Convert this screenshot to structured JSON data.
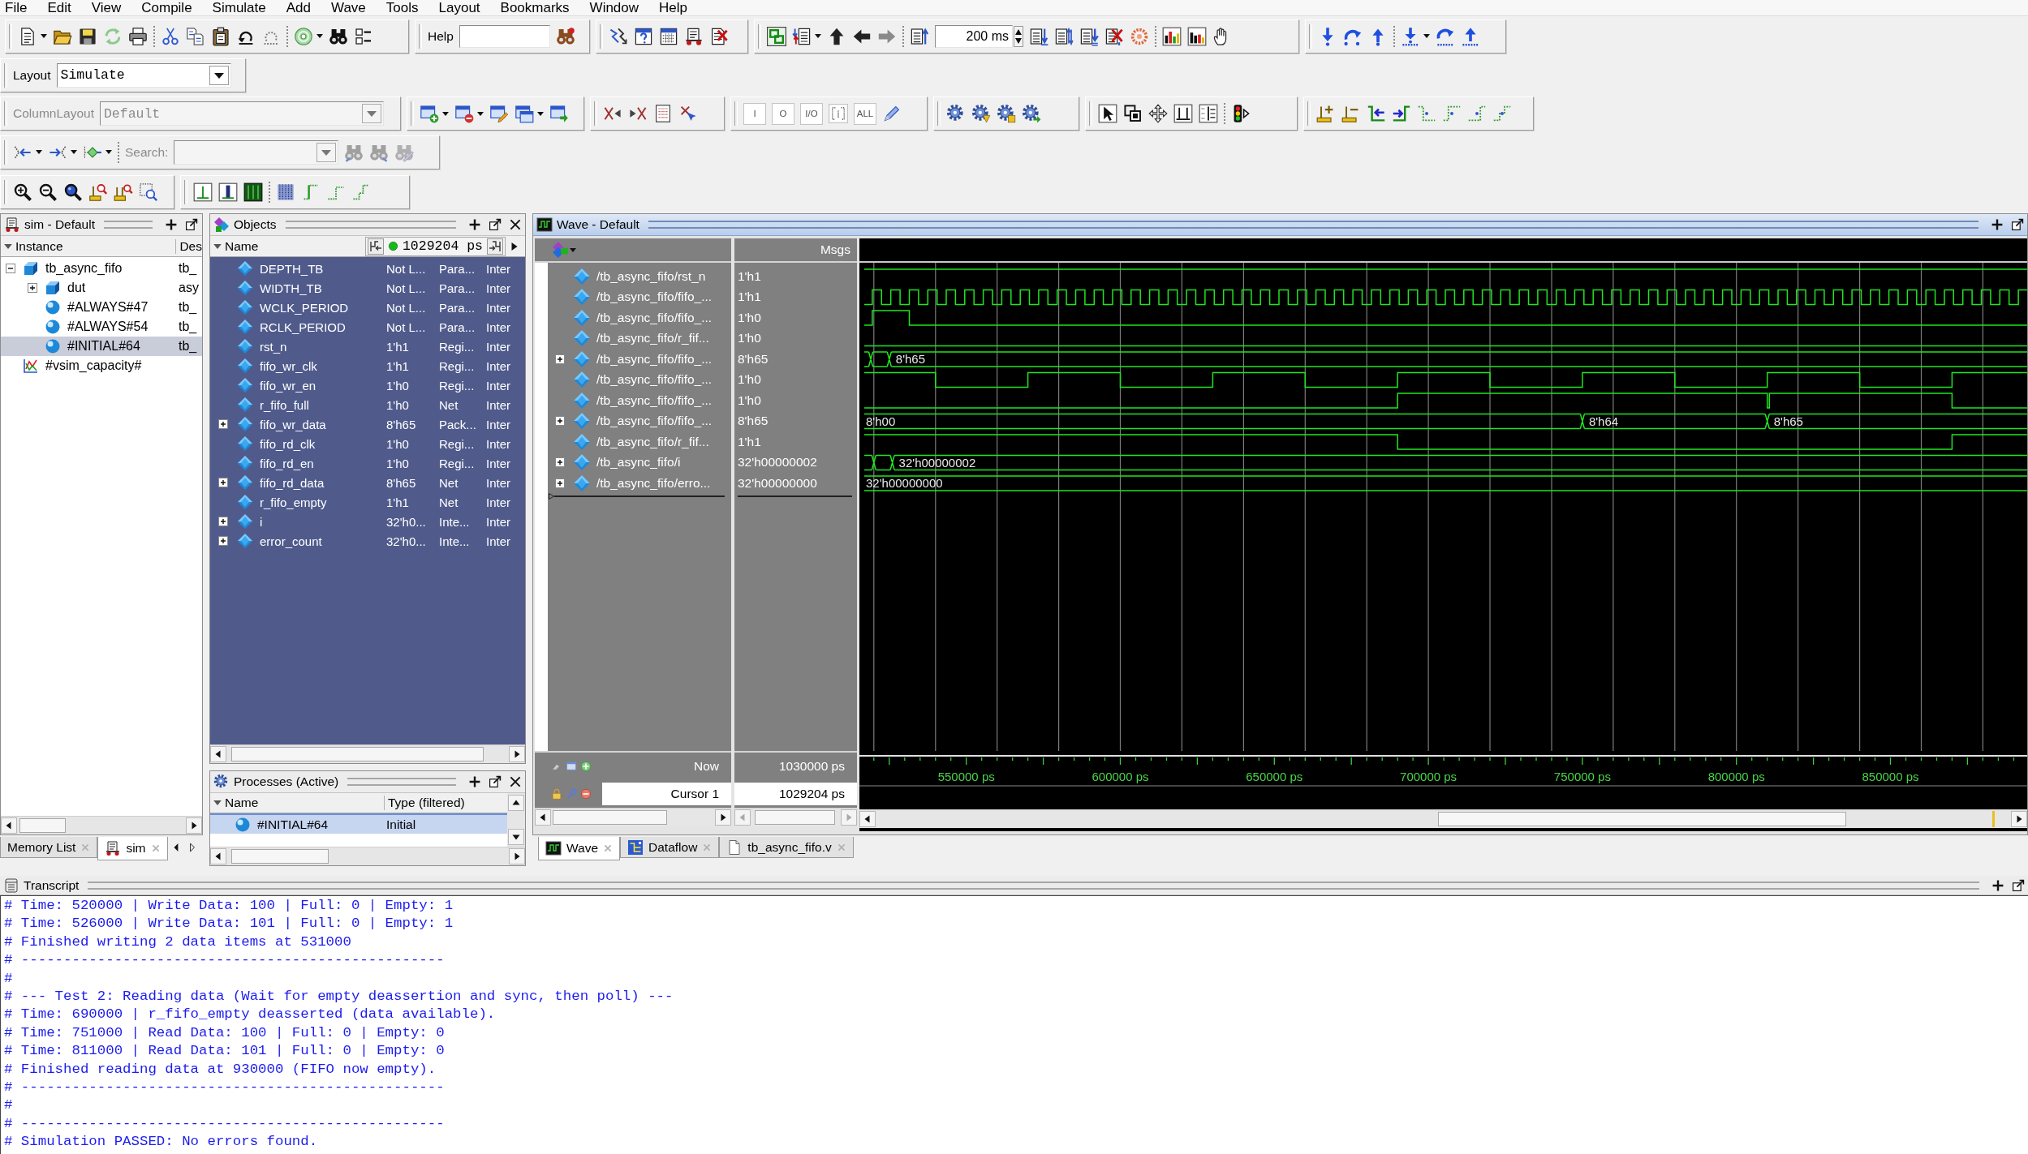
{
  "menu_bar": [
    "File",
    "Edit",
    "View",
    "Compile",
    "Simulate",
    "Add",
    "Wave",
    "Tools",
    "Layout",
    "Bookmarks",
    "Window",
    "Help"
  ],
  "toolbar": {
    "help_label": "Help",
    "run_length": "200 ms",
    "layout": {
      "label": "Layout",
      "value": "Simulate"
    },
    "column_layout": {
      "label": "ColumnLayout",
      "value": "Default",
      "disabled": true
    },
    "object_filters": [
      "I",
      "O",
      "I/O",
      "ALL"
    ],
    "search": {
      "label": "Search:",
      "disabled": true
    }
  },
  "sim_panel": {
    "title": "sim - Default",
    "columns": [
      "Instance",
      "Des"
    ],
    "tree": [
      {
        "name": "tb_async_fifo",
        "design": "tb_",
        "kind": "module",
        "expanded": true,
        "selected": false,
        "children": [
          {
            "name": "dut",
            "design": "asy",
            "kind": "module",
            "expanded": false,
            "selected": false
          },
          {
            "name": "#ALWAYS#47",
            "design": "tb_",
            "kind": "process",
            "selected": false
          },
          {
            "name": "#ALWAYS#54",
            "design": "tb_",
            "kind": "process",
            "selected": false
          },
          {
            "name": "#INITIAL#64",
            "design": "tb_",
            "kind": "process",
            "selected": true
          }
        ]
      },
      {
        "name": "#vsim_capacity#",
        "kind": "capacity",
        "selected": false
      }
    ],
    "tabs": [
      {
        "label": "Memory List",
        "kind": "memory",
        "selected": false
      },
      {
        "label": "sim",
        "kind": "sim",
        "selected": true
      }
    ]
  },
  "objects_panel": {
    "title": "Objects",
    "column": "Name",
    "time": "1029204 ps",
    "rows": [
      {
        "name": "DEPTH_TB",
        "value": "Not L...",
        "column_3": "Para...",
        "column_4": "Inter"
      },
      {
        "name": "WIDTH_TB",
        "value": "Not L...",
        "column_3": "Para...",
        "column_4": "Inter"
      },
      {
        "name": "WCLK_PERIOD",
        "value": "Not L...",
        "column_3": "Para...",
        "column_4": "Inter"
      },
      {
        "name": "RCLK_PERIOD",
        "value": "Not L...",
        "column_3": "Para...",
        "column_4": "Inter"
      },
      {
        "name": "rst_n",
        "value": "1'h1",
        "column_3": "Regi...",
        "column_4": "Inter"
      },
      {
        "name": "fifo_wr_clk",
        "value": "1'h1",
        "column_3": "Regi...",
        "column_4": "Inter"
      },
      {
        "name": "fifo_wr_en",
        "value": "1'h0",
        "column_3": "Regi...",
        "column_4": "Inter"
      },
      {
        "name": "r_fifo_full",
        "value": "1'h0",
        "column_3": "Net",
        "column_4": "Inter"
      },
      {
        "name": "fifo_wr_data",
        "value": "8'h65",
        "column_3": "Pack...",
        "column_4": "Inter",
        "expanded": false
      },
      {
        "name": "fifo_rd_clk",
        "value": "1'h0",
        "column_3": "Regi...",
        "column_4": "Inter"
      },
      {
        "name": "fifo_rd_en",
        "value": "1'h0",
        "column_3": "Regi...",
        "column_4": "Inter"
      },
      {
        "name": "fifo_rd_data",
        "value": "8'h65",
        "column_3": "Net",
        "column_4": "Inter",
        "expanded": false
      },
      {
        "name": "r_fifo_empty",
        "value": "1'h1",
        "column_3": "Net",
        "column_4": "Inter"
      },
      {
        "name": "i",
        "value": "32'h0...",
        "column_3": "Inte...",
        "column_4": "Inter",
        "expanded": false
      },
      {
        "name": "error_count",
        "value": "32'h0...",
        "column_3": "Inte...",
        "column_4": "Inter",
        "expanded": false
      }
    ]
  },
  "processes_panel": {
    "title": "Processes (Active)",
    "columns": [
      "Name",
      "Type (filtered)"
    ],
    "rows": [
      {
        "name": "#INITIAL#64",
        "type": "Initial",
        "selected": true
      }
    ]
  },
  "wave_panel": {
    "title": "Wave - Default",
    "value_header": "Msgs",
    "signals": [
      {
        "name": "/tb_async_fifo/rst_n",
        "value": "1'h1"
      },
      {
        "name": "/tb_async_fifo/fifo_...",
        "value": "1'h1"
      },
      {
        "name": "/tb_async_fifo/fifo_...",
        "value": "1'h0"
      },
      {
        "name": "/tb_async_fifo/r_fif...",
        "value": "1'h0"
      },
      {
        "name": "/tb_async_fifo/fifo_...",
        "value": "8'h65",
        "expanded": false,
        "trace_labels": [
          "8'h65"
        ]
      },
      {
        "name": "/tb_async_fifo/fifo_...",
        "value": "1'h0"
      },
      {
        "name": "/tb_async_fifo/fifo_...",
        "value": "1'h0"
      },
      {
        "name": "/tb_async_fifo/fifo_...",
        "value": "8'h65",
        "expanded": false,
        "trace_labels": [
          "8'h00",
          "8'h64",
          "8'h65"
        ]
      },
      {
        "name": "/tb_async_fifo/r_fif...",
        "value": "1'h1"
      },
      {
        "name": "/tb_async_fifo/i",
        "value": "32'h00000002",
        "expanded": false,
        "trace_labels": [
          "32'h00000002"
        ]
      },
      {
        "name": "/tb_async_fifo/erro...",
        "value": "32'h00000000",
        "expanded": false,
        "trace_labels": [
          "32'h00000000"
        ]
      }
    ],
    "now": {
      "label": "Now",
      "value": "1030000 ps"
    },
    "cursor": {
      "label": "Cursor 1",
      "value": "1029204 ps"
    },
    "time_axis": [
      "550000 ps",
      "600000 ps",
      "650000 ps",
      "700000 ps",
      "750000 ps",
      "800000 ps",
      "850000 ps"
    ],
    "tabs": [
      {
        "label": "Wave",
        "kind": "wave",
        "selected": true
      },
      {
        "label": "Dataflow",
        "kind": "dataflow",
        "selected": false
      },
      {
        "label": "tb_async_fifo.v",
        "kind": "file",
        "selected": false
      }
    ]
  },
  "transcript": {
    "title": "Transcript",
    "lines": [
      "# Time: 520000 | Write Data: 100 | Full: 0 | Empty: 1",
      "# Time: 526000 | Write Data: 101 | Full: 0 | Empty: 1",
      "# Finished writing 2 data items at 531000",
      "# --------------------------------------------------",
      "#",
      "# --- Test 2: Reading data (Wait for empty deassertion and sync, then poll) ---",
      "# Time: 690000 | r_fifo_empty deasserted (data available).",
      "# Time: 751000 | Read Data: 100 | Full: 0 | Empty: 0",
      "# Time: 811000 | Read Data: 101 | Full: 0 | Empty: 0",
      "# Finished reading data at 930000 (FIFO now empty).",
      "# --------------------------------------------------",
      "#",
      "# --------------------------------------------------",
      "# Simulation PASSED: No errors found."
    ]
  }
}
